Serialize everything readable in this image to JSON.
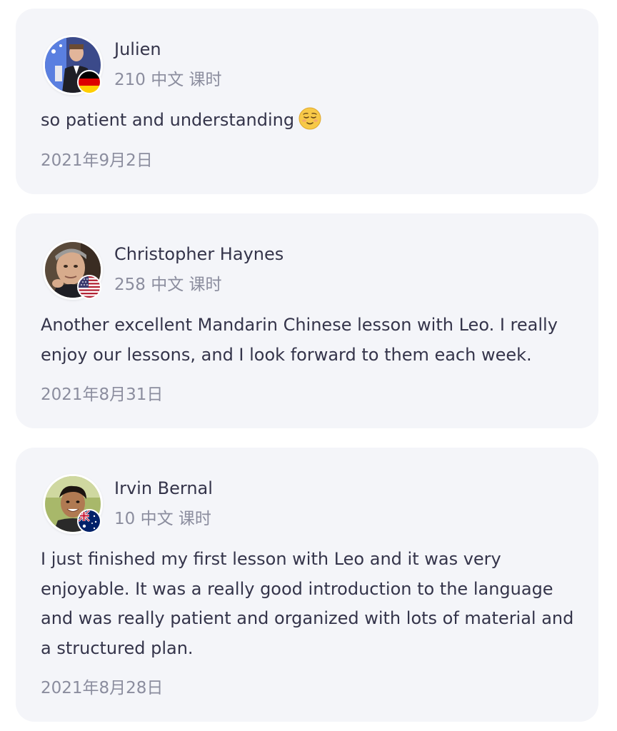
{
  "reviews": [
    {
      "name": "Julien",
      "lessons": "210 中文 课时",
      "text": "so patient and understanding",
      "emoji": "relieved-face-emoji",
      "date": "2021年9月2日",
      "flag": "germany-flag-icon"
    },
    {
      "name": "Christopher Haynes",
      "lessons": "258 中文 课时",
      "text": "Another excellent Mandarin Chinese lesson with Leo. I really enjoy our lessons, and I look forward to them each week.",
      "date": "2021年8月31日",
      "flag": "usa-flag-icon"
    },
    {
      "name": "Irvin Bernal",
      "lessons": "10 中文 课时",
      "text": "I just finished my first lesson with Leo and it was very enjoyable. It was a really good introduction to the language and was really patient and organized with lots of material and a structured plan.",
      "date": "2021年8月28日",
      "flag": "australia-flag-icon"
    }
  ],
  "colors": {
    "card_background": "#f4f5f9",
    "primary_text": "#34344a",
    "secondary_text": "#8b8d9e"
  }
}
